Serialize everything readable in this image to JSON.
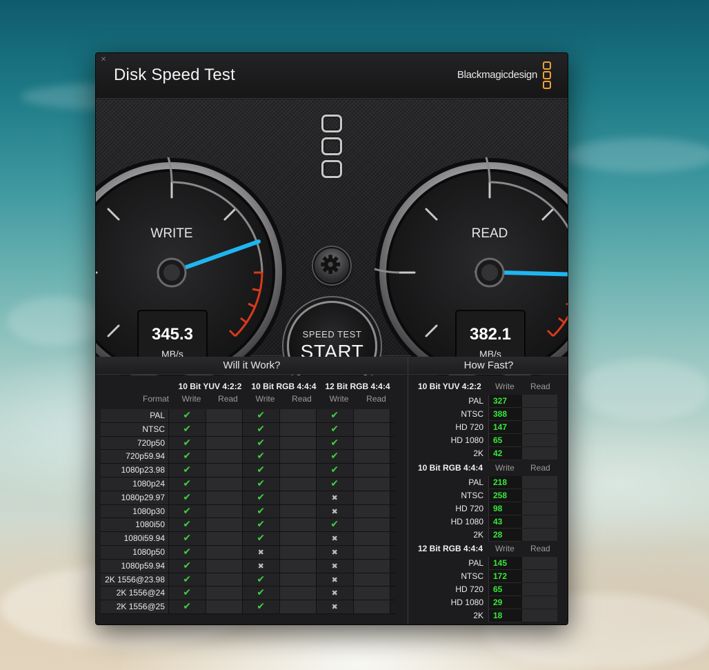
{
  "app": {
    "title": "Disk Speed Test",
    "brand": "Blackmagicdesign",
    "accent": "#f2a133"
  },
  "gauges": {
    "write": {
      "label": "WRITE",
      "value": "345.3",
      "unit": "MB/s",
      "needle_color": "#1fb6f0"
    },
    "read": {
      "label": "READ",
      "value": "382.1",
      "unit": "MB/s",
      "needle_color": "#1fb6f0"
    }
  },
  "controls": {
    "settings_icon": "gear-icon",
    "start_small": "SPEED TEST",
    "start_big": "START"
  },
  "will_it_work": {
    "title": "Will it Work?",
    "format_header": "Format",
    "groups": [
      {
        "name": "10 Bit YUV 4:2:2",
        "write": "Write",
        "read": "Read"
      },
      {
        "name": "10 Bit RGB 4:4:4",
        "write": "Write",
        "read": "Read"
      },
      {
        "name": "12 Bit RGB 4:4:4",
        "write": "Write",
        "read": "Read"
      }
    ],
    "rows": [
      {
        "format": "PAL",
        "marks": [
          "ok",
          "ok",
          "ok"
        ]
      },
      {
        "format": "NTSC",
        "marks": [
          "ok",
          "ok",
          "ok"
        ]
      },
      {
        "format": "720p50",
        "marks": [
          "ok",
          "ok",
          "ok"
        ]
      },
      {
        "format": "720p59.94",
        "marks": [
          "ok",
          "ok",
          "ok"
        ]
      },
      {
        "format": "1080p23.98",
        "marks": [
          "ok",
          "ok",
          "ok"
        ]
      },
      {
        "format": "1080p24",
        "marks": [
          "ok",
          "ok",
          "ok"
        ]
      },
      {
        "format": "1080p29.97",
        "marks": [
          "ok",
          "ok",
          "no"
        ]
      },
      {
        "format": "1080p30",
        "marks": [
          "ok",
          "ok",
          "no"
        ]
      },
      {
        "format": "1080i50",
        "marks": [
          "ok",
          "ok",
          "ok"
        ]
      },
      {
        "format": "1080i59.94",
        "marks": [
          "ok",
          "ok",
          "no"
        ]
      },
      {
        "format": "1080p50",
        "marks": [
          "ok",
          "no",
          "no"
        ]
      },
      {
        "format": "1080p59.94",
        "marks": [
          "ok",
          "no",
          "no"
        ]
      },
      {
        "format": "2K 1556@23.98",
        "marks": [
          "ok",
          "ok",
          "no"
        ]
      },
      {
        "format": "2K 1556@24",
        "marks": [
          "ok",
          "ok",
          "no"
        ]
      },
      {
        "format": "2K 1556@25",
        "marks": [
          "ok",
          "ok",
          "no"
        ]
      }
    ]
  },
  "how_fast": {
    "title": "How Fast?",
    "groups": [
      {
        "name": "10 Bit YUV 4:2:2",
        "write": "Write",
        "read": "Read",
        "rows": [
          {
            "format": "PAL",
            "value": "327"
          },
          {
            "format": "NTSC",
            "value": "388"
          },
          {
            "format": "HD 720",
            "value": "147"
          },
          {
            "format": "HD 1080",
            "value": "65"
          },
          {
            "format": "2K",
            "value": "42"
          }
        ]
      },
      {
        "name": "10 Bit RGB 4:4:4",
        "write": "Write",
        "read": "Read",
        "rows": [
          {
            "format": "PAL",
            "value": "218"
          },
          {
            "format": "NTSC",
            "value": "258"
          },
          {
            "format": "HD 720",
            "value": "98"
          },
          {
            "format": "HD 1080",
            "value": "43"
          },
          {
            "format": "2K",
            "value": "28"
          }
        ]
      },
      {
        "name": "12 Bit RGB 4:4:4",
        "write": "Write",
        "read": "Read",
        "rows": [
          {
            "format": "PAL",
            "value": "145"
          },
          {
            "format": "NTSC",
            "value": "172"
          },
          {
            "format": "HD 720",
            "value": "65"
          },
          {
            "format": "HD 1080",
            "value": "29"
          },
          {
            "format": "2K",
            "value": "18"
          }
        ]
      }
    ]
  }
}
